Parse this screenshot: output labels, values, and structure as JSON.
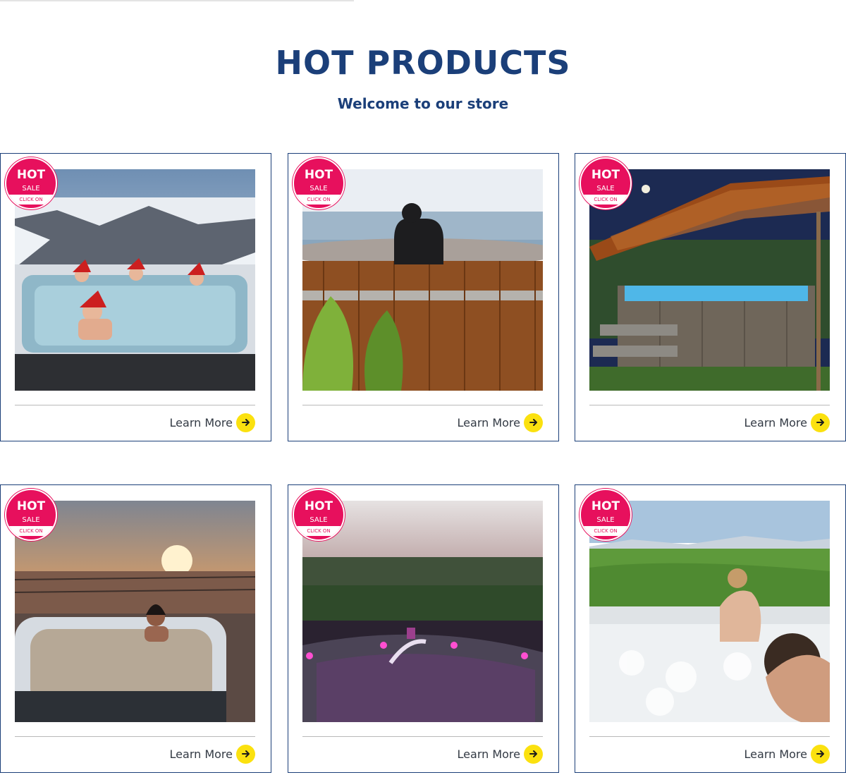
{
  "section": {
    "title": "HOT PRODUCTS",
    "subtitle": "Welcome to our store"
  },
  "colors": {
    "heading": "#1b3f79",
    "card_border": "#1b3f79",
    "badge": "#e7105d",
    "arrow_button": "#fbe10f"
  },
  "badge": {
    "hot": "HOT",
    "sale": "SALE",
    "cta": "CLICK ON"
  },
  "products": [
    {
      "photo": "hot-tub-snowy-mountain-santa-hats-photo",
      "learn_more": "Learn More",
      "arrow_icon": "arrow-right-icon"
    },
    {
      "photo": "wooden-tub-ocean-view-photo",
      "learn_more": "Learn More",
      "arrow_icon": "arrow-right-icon"
    },
    {
      "photo": "swim-spa-pergola-night-photo",
      "learn_more": "Learn More",
      "arrow_icon": "arrow-right-icon"
    },
    {
      "photo": "hot-tub-sunset-deck-photo",
      "learn_more": "Learn More",
      "arrow_icon": "arrow-right-icon"
    },
    {
      "photo": "hot-tub-pink-lights-dusk-photo",
      "learn_more": "Learn More",
      "arrow_icon": "arrow-right-icon"
    },
    {
      "photo": "hot-tub-green-fields-couple-photo",
      "learn_more": "Learn More",
      "arrow_icon": "arrow-right-icon"
    }
  ]
}
